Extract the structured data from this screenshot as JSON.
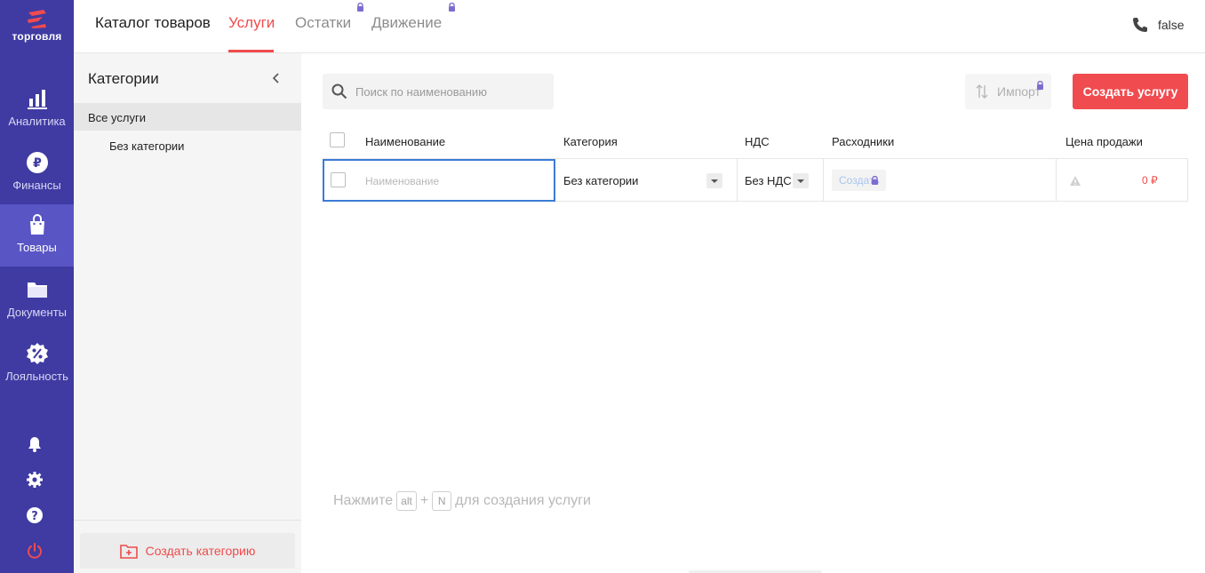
{
  "brand": {
    "name": "торговля"
  },
  "rail": {
    "items": [
      {
        "label": "Аналитика",
        "icon": "bar-chart-icon"
      },
      {
        "label": "Финансы",
        "icon": "ruble-icon"
      },
      {
        "label": "Товары",
        "icon": "shopping-bag-icon",
        "active": true
      },
      {
        "label": "Документы",
        "icon": "folder-icon"
      },
      {
        "label": "Лояльность",
        "icon": "percent-badge-icon"
      }
    ],
    "bottom_icons": [
      "bell-icon",
      "gear-icon",
      "help-icon",
      "power-icon"
    ]
  },
  "topbar": {
    "tabs": [
      "Каталог товаров",
      "Услуги",
      "Остатки",
      "Движение"
    ],
    "active_tab": "Услуги",
    "phone": "false"
  },
  "categories": {
    "title": "Категории",
    "items": [
      "Все услуги",
      "Без категории"
    ],
    "create_label": "Создать категорию"
  },
  "toolbar": {
    "search_placeholder": "Поиск по наименованию",
    "import_label": "Импорт",
    "create_label": "Создать услугу"
  },
  "table": {
    "headers": [
      "Наименование",
      "Категория",
      "НДС",
      "Расходники",
      "Цена продажи"
    ],
    "new_row": {
      "name_placeholder": "Наименование",
      "category": "Без категории",
      "vat": "Без НДС",
      "consumables_action": "Создать",
      "price": "0 ₽"
    }
  },
  "hint": {
    "prefix": "Нажмите",
    "key1": "alt",
    "plus": "+",
    "key2": "N",
    "suffix": "для создания услуги"
  },
  "colors": {
    "accent": "#ef4b4b",
    "rail": "#3f3ba2",
    "rail_active": "#5955c5",
    "focus": "#3c7bd6",
    "lock": "#7f6bd0"
  }
}
